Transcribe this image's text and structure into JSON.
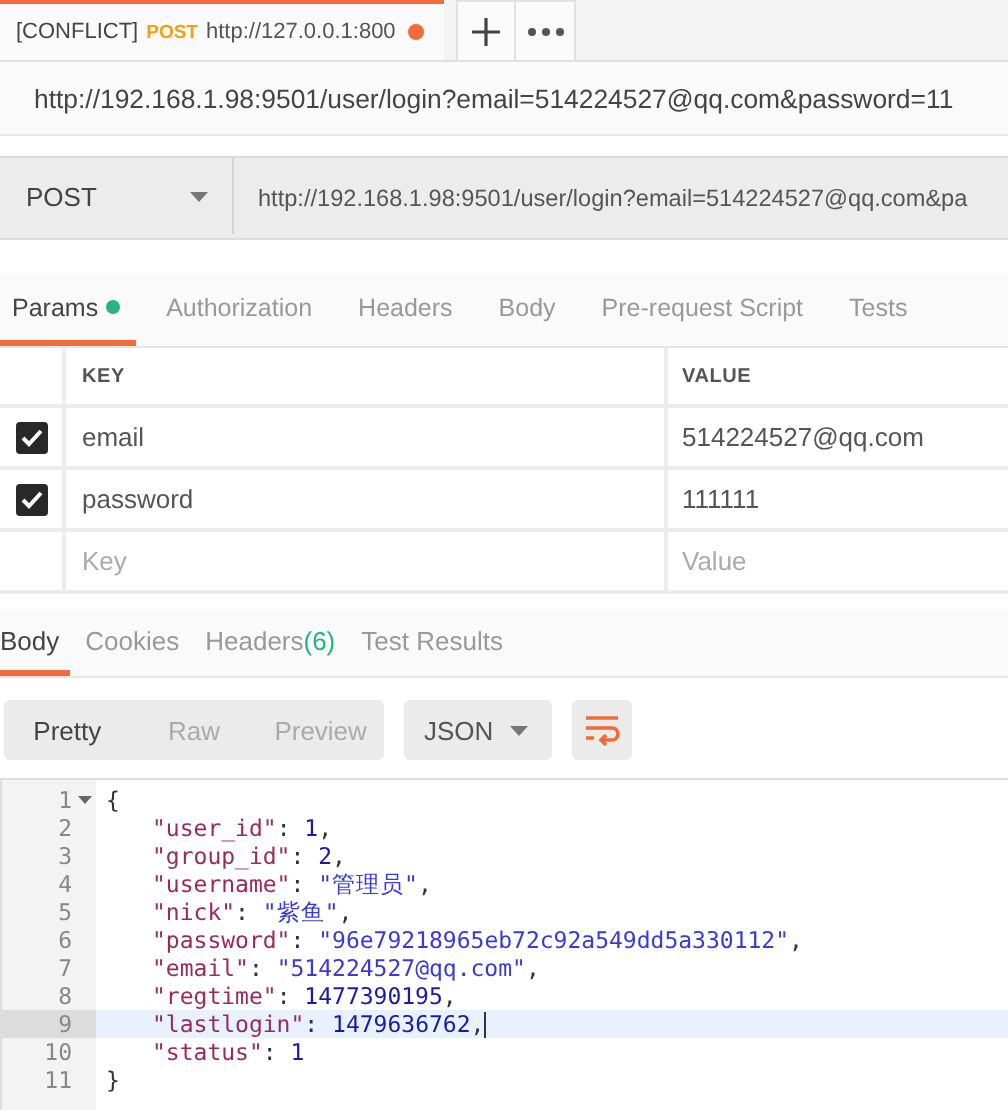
{
  "request_tab": {
    "conflict": "[CONFLICT]",
    "method": "POST",
    "url": "http://127.0.0.1:800",
    "unsaved": true
  },
  "request_title": "http://192.168.1.98:9501/user/login?email=514224527@qq.com&password=11",
  "request": {
    "method": "POST",
    "url": "http://192.168.1.98:9501/user/login?email=514224527@qq.com&pa"
  },
  "request_tabs": [
    {
      "label": "Params",
      "selected": true,
      "indicator": true
    },
    {
      "label": "Authorization",
      "selected": false,
      "indicator": false
    },
    {
      "label": "Headers",
      "selected": false,
      "indicator": false
    },
    {
      "label": "Body",
      "selected": false,
      "indicator": false
    },
    {
      "label": "Pre-request Script",
      "selected": false,
      "indicator": false
    },
    {
      "label": "Tests",
      "selected": false,
      "indicator": false
    }
  ],
  "params": {
    "columns": [
      "KEY",
      "VALUE"
    ],
    "rows": [
      {
        "checked": true,
        "key": "email",
        "value": "514224527@qq.com"
      },
      {
        "checked": true,
        "key": "password",
        "value": "111111"
      }
    ],
    "new_row": {
      "key_placeholder": "Key",
      "value_placeholder": "Value"
    }
  },
  "response_tabs": [
    {
      "label": "Body",
      "selected": true
    },
    {
      "label": "Cookies",
      "selected": false
    },
    {
      "label": "Headers",
      "count": "(6)",
      "selected": false
    },
    {
      "label": "Test Results",
      "selected": false
    }
  ],
  "view_modes": [
    {
      "label": "Pretty",
      "selected": true
    },
    {
      "label": "Raw",
      "selected": false
    },
    {
      "label": "Preview",
      "selected": false
    }
  ],
  "format": "JSON",
  "code_lines": [
    {
      "number": "1",
      "fold": true,
      "selected": false,
      "tokens": [
        {
          "kind": "punct",
          "text": "{"
        }
      ],
      "children": [
        {
          "number": "2",
          "fold": false,
          "selected": false,
          "tokens": [
            {
              "kind": "key",
              "text": "\"user_id\""
            },
            {
              "kind": "punct",
              "text": ": "
            },
            {
              "kind": "number",
              "text": "1"
            },
            {
              "kind": "punct",
              "text": ","
            }
          ]
        },
        {
          "number": "3",
          "fold": false,
          "selected": false,
          "tokens": [
            {
              "kind": "key",
              "text": "\"group_id\""
            },
            {
              "kind": "punct",
              "text": ": "
            },
            {
              "kind": "number",
              "text": "2"
            },
            {
              "kind": "punct",
              "text": ","
            }
          ]
        },
        {
          "number": "4",
          "fold": false,
          "selected": false,
          "tokens": [
            {
              "kind": "key",
              "text": "\"username\""
            },
            {
              "kind": "punct",
              "text": ": "
            },
            {
              "kind": "string",
              "text": "\"管理员\""
            },
            {
              "kind": "punct",
              "text": ","
            }
          ]
        },
        {
          "number": "5",
          "fold": false,
          "selected": false,
          "tokens": [
            {
              "kind": "key",
              "text": "\"nick\""
            },
            {
              "kind": "punct",
              "text": ": "
            },
            {
              "kind": "string",
              "text": "\"紫鱼\""
            },
            {
              "kind": "punct",
              "text": ","
            }
          ]
        },
        {
          "number": "6",
          "fold": false,
          "selected": false,
          "tokens": [
            {
              "kind": "key",
              "text": "\"password\""
            },
            {
              "kind": "punct",
              "text": ": "
            },
            {
              "kind": "string",
              "text": "\"96e79218965eb72c92a549dd5a330112\""
            },
            {
              "kind": "punct",
              "text": ","
            }
          ]
        },
        {
          "number": "7",
          "fold": false,
          "selected": false,
          "tokens": [
            {
              "kind": "key",
              "text": "\"email\""
            },
            {
              "kind": "punct",
              "text": ": "
            },
            {
              "kind": "string",
              "text": "\"514224527@qq.com\""
            },
            {
              "kind": "punct",
              "text": ","
            }
          ]
        },
        {
          "number": "8",
          "fold": false,
          "selected": false,
          "tokens": [
            {
              "kind": "key",
              "text": "\"regtime\""
            },
            {
              "kind": "punct",
              "text": ": "
            },
            {
              "kind": "number",
              "text": "1477390195"
            },
            {
              "kind": "punct",
              "text": ","
            }
          ]
        },
        {
          "number": "9",
          "fold": false,
          "selected": true,
          "tokens": [
            {
              "kind": "key",
              "text": "\"lastlogin\""
            },
            {
              "kind": "punct",
              "text": ": "
            },
            {
              "kind": "number",
              "text": "1479636762"
            },
            {
              "kind": "punct",
              "text": ","
            }
          ]
        },
        {
          "number": "10",
          "fold": false,
          "selected": false,
          "tokens": [
            {
              "kind": "key",
              "text": "\"status\""
            },
            {
              "kind": "punct",
              "text": ": "
            },
            {
              "kind": "number",
              "text": "1"
            }
          ]
        }
      ]
    },
    {
      "number": "11",
      "fold": false,
      "selected": false,
      "tokens": [
        {
          "kind": "punct",
          "text": "}"
        }
      ]
    }
  ]
}
